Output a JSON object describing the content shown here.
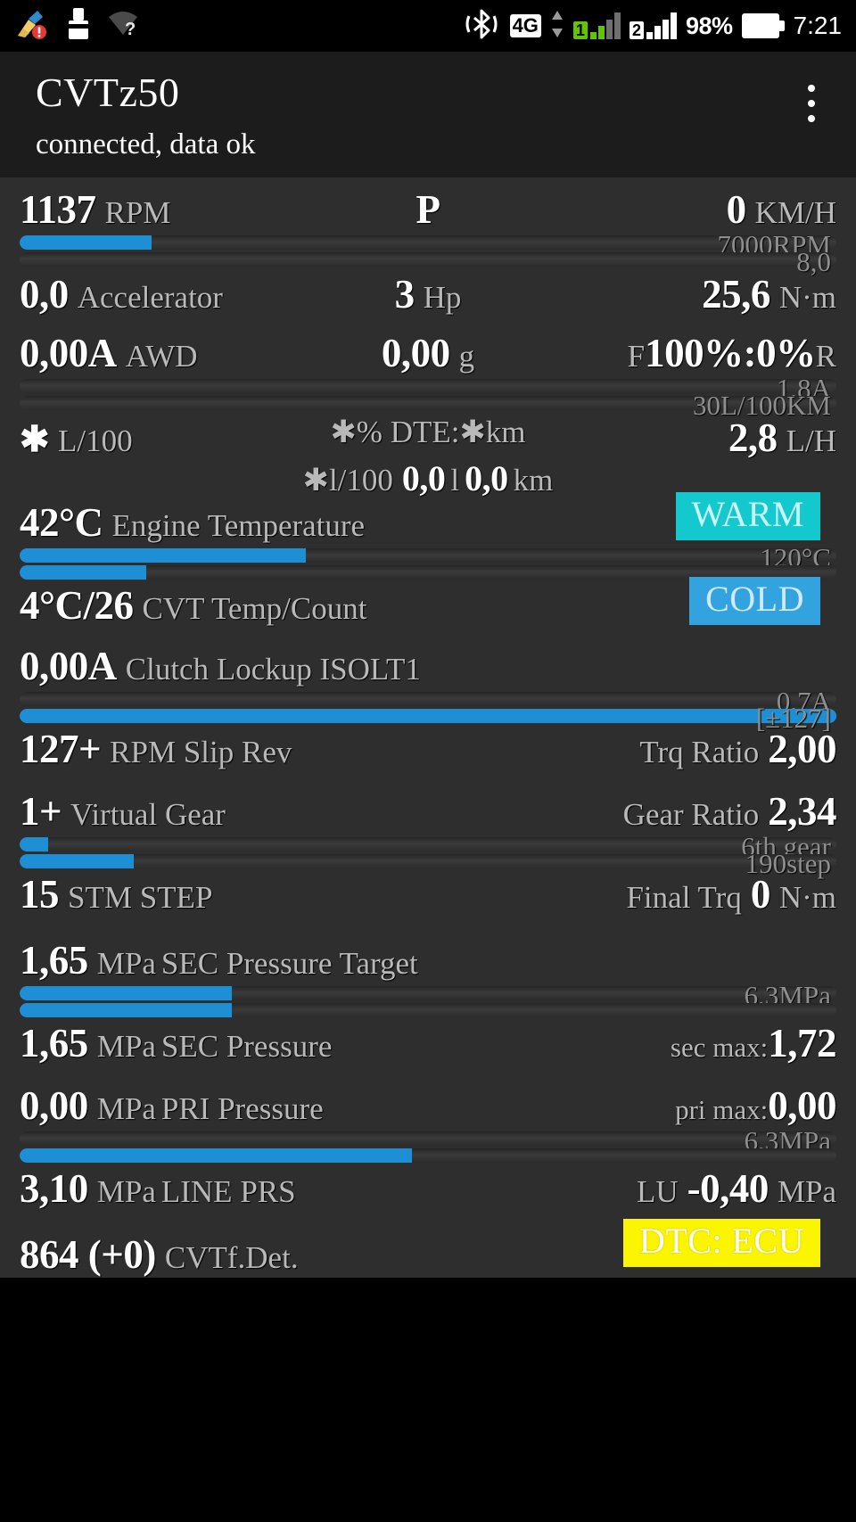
{
  "statusbar": {
    "icons": [
      "broom-alert-icon",
      "cleaner-icon",
      "wifi-question-icon",
      "bluetooth-icon"
    ],
    "network_type": "4G",
    "sim1_label": "1",
    "sim2_label": "2",
    "battery_percent": "98%",
    "clock": "7:21"
  },
  "appbar": {
    "title": "CVTz50",
    "subtitle": "connected, data ok",
    "menu_icon": "kebab-menu-icon"
  },
  "dashboard": {
    "rpm": {
      "value": "1137",
      "unit": "RPM",
      "gear": "P",
      "speed": "0",
      "speed_unit": "KM/H",
      "bar_percent": 16.2,
      "bar_max_label": "7000RPM"
    },
    "accel": {
      "bar2_percent": 0,
      "bar2_max_label": "8,0",
      "value": "0,0",
      "label": "Accelerator",
      "hp_value": "3",
      "hp_unit": "Hp",
      "torque_value": "25,6",
      "torque_unit": "N·m"
    },
    "awd": {
      "value": "0,00A",
      "label": "AWD",
      "g_value": "0,00",
      "g_unit": "g",
      "split_prefix": "F",
      "split_value": "100%:0%",
      "split_suffix": "R",
      "bar_percent": 0,
      "bar_max_label": "1,8A",
      "bar2_percent": 0,
      "bar2_max_label": "30L/100KM"
    },
    "fuel": {
      "l100_value": "✱",
      "l100_unit": "L/100",
      "dte_text": "✱% DTE:✱km",
      "lh_value": "2,8",
      "lh_unit": "L/H",
      "trip_prefix": "✱l/100",
      "trip_l": "0,0",
      "trip_l_unit": "l",
      "trip_km": "0,0",
      "trip_km_unit": "km"
    },
    "engine_temp": {
      "value": "42°C",
      "label": "Engine Temperature",
      "badge": "WARM",
      "bar_percent": 35,
      "bar_max_label": "120°C",
      "bar2_percent": 15.5
    },
    "cvt_temp": {
      "value": "4°C/26",
      "label": "CVT Temp/Count",
      "badge": "COLD"
    },
    "clutch": {
      "value": "0,00A",
      "label": "Clutch Lockup ISOLT1",
      "bar_percent": 0,
      "bar_max_label": "0,7A",
      "bar2_percent": 100,
      "bar2_max_label": "[±127]"
    },
    "slip": {
      "value": "127+",
      "label": "RPM Slip Rev",
      "right_label": "Trq Ratio",
      "right_value": "2,00"
    },
    "virtual_gear": {
      "value": "1+",
      "label": "Virtual Gear",
      "right_label": "Gear Ratio",
      "right_value": "2,34",
      "bar_percent": 3.5,
      "bar_max_label": "6th gear",
      "bar2_percent": 14,
      "bar2_max_label": "190step"
    },
    "stm": {
      "value": "15",
      "label": "STM STEP",
      "right_label": "Final Trq",
      "right_value": "0",
      "right_unit": "N·m"
    },
    "sec_target": {
      "value": "1,65",
      "unit": "MPa",
      "label": "SEC Pressure Target",
      "bar_percent": 26,
      "bar_max_label": "6,3MPa"
    },
    "sec_pressure": {
      "value": "1,65",
      "unit": "MPa",
      "label": "SEC Pressure",
      "bar_percent": 26,
      "right_label": "sec max:",
      "right_value": "1,72"
    },
    "pri_pressure": {
      "value": "0,00",
      "unit": "MPa",
      "label": "PRI Pressure",
      "right_label": "pri max:",
      "right_value": "0,00",
      "bar_percent": 0,
      "bar_max_label": "6,3MPa"
    },
    "line_prs": {
      "value": "3,10",
      "unit": "MPa",
      "label": "LINE PRS",
      "right_label": "LU",
      "right_value": "-0,40",
      "right_unit": "MPa",
      "bar_percent": 48
    },
    "cvtf": {
      "value": "864 (+0)",
      "label": "CVTf.Det.",
      "badge": "DTC: ECU"
    }
  },
  "colors": {
    "accent_blue": "#1e8fd5",
    "warm": "#13c9cd",
    "cold": "#33a3e0",
    "dtc": "#fcf500",
    "panel": "#2e2e2e",
    "appbar": "#1c1c1c"
  }
}
